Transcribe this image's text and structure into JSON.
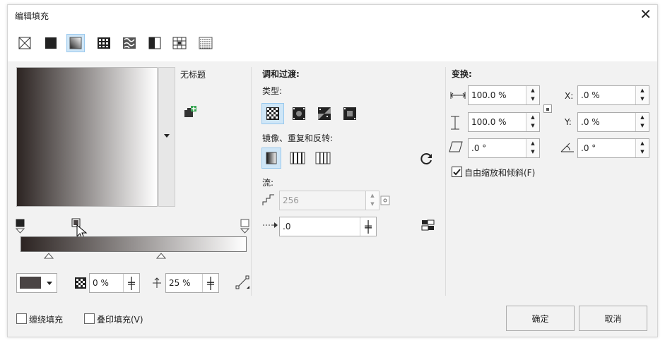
{
  "window": {
    "title": "编辑填充"
  },
  "fill_types": [
    {
      "name": "no-fill-icon"
    },
    {
      "name": "uniform-fill-icon"
    },
    {
      "name": "fountain-fill-icon",
      "selected": true
    },
    {
      "name": "vector-pattern-fill-icon"
    },
    {
      "name": "bitmap-pattern-fill-icon"
    },
    {
      "name": "two-color-pattern-fill-icon"
    },
    {
      "name": "texture-fill-icon"
    },
    {
      "name": "postscript-fill-icon"
    }
  ],
  "preview": {
    "name": "无标题"
  },
  "colors": {
    "start": "#2c2422",
    "end": "#ffffff",
    "node": "#4a4444",
    "accent": "#1e6fbf"
  },
  "ramp": {
    "node_color_swatch": "#4a4444",
    "transparency": "0 %",
    "position": "25 %"
  },
  "blend": {
    "heading": "调和过渡:",
    "type_label": "类型:",
    "mirror_label": "镜像、重复和反转:",
    "flow_label": "流:",
    "steps_value": "256",
    "acceleration_value": ".0"
  },
  "transform": {
    "heading": "变换:",
    "width_value": "100.0 %",
    "height_value": "100.0 %",
    "x_label": "X:",
    "x_value": ".0 %",
    "y_label": "Y:",
    "y_value": ".0 %",
    "skew_value": ".0 °",
    "rotate_value": ".0 °",
    "free_scale_label": "自由缩放和倾斜(F)",
    "free_scale_checked": true
  },
  "footer": {
    "wrap_fill_label": "缠绕填充",
    "overprint_fill_label": "叠印填充(V)",
    "ok_label": "确定",
    "cancel_label": "取消"
  }
}
